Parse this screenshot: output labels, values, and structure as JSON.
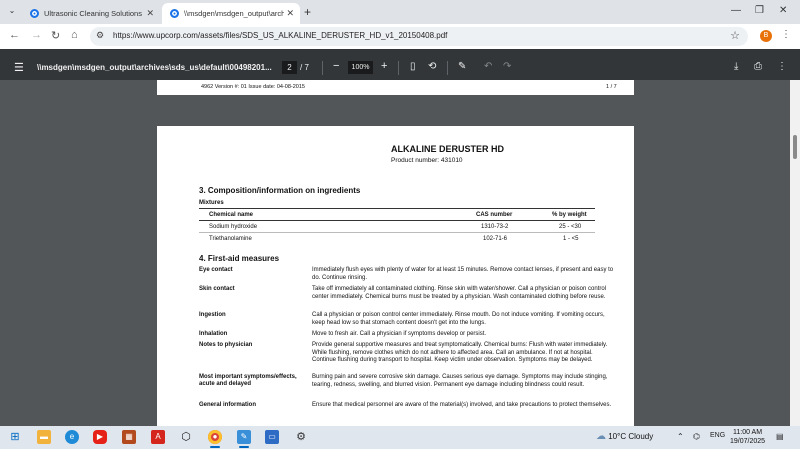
{
  "browser": {
    "tabs": [
      {
        "title": "Ultrasonic Cleaning Solutions &",
        "active": false
      },
      {
        "title": "\\\\msdgen\\msdgen_output\\arch",
        "active": true
      }
    ],
    "new_tab": "+",
    "url": "https://www.upcorp.com/assets/files/SDS_US_ALKALINE_DERUSTER_HD_v1_20150408.pdf",
    "profile_initial": "B"
  },
  "pdf_toolbar": {
    "filename": "\\\\msdgen\\msdgen_output\\archives\\sds_us\\default\\00498201...",
    "current_page": "2",
    "total_pages": "/ 7",
    "zoom": "100%"
  },
  "page1": {
    "footer": "4962    Version #: 01    Issue date: 04-08-2015",
    "page_number": "1 / 7"
  },
  "page2": {
    "title": "ALKALINE DERUSTER HD",
    "product_number": "Product number: 431010",
    "section3": {
      "heading": "3. Composition/information on ingredients",
      "subheading": "Mixtures",
      "columns": [
        "Chemical name",
        "CAS number",
        "% by weight"
      ],
      "rows": [
        [
          "Sodium hydroxide",
          "1310-73-2",
          "25 - <30"
        ],
        [
          "Triethanolamine",
          "102-71-6",
          "1 - <5"
        ]
      ]
    },
    "section4": {
      "heading": "4. First-aid measures",
      "items": [
        {
          "label": "Eye contact",
          "text": "Immediately flush eyes with plenty of water for at least 15 minutes. Remove contact lenses, if present and easy to do. Continue rinsing."
        },
        {
          "label": "Skin contact",
          "text": "Take off immediately all contaminated clothing. Rinse skin with water/shower. Call a physician or poison control center immediately. Chemical burns must be treated by a physician. Wash contaminated clothing before reuse."
        },
        {
          "label": "Ingestion",
          "text": "Call a physician or poison control center immediately. Rinse mouth. Do not induce vomiting. If vomiting occurs, keep head low so that stomach content doesn't get into the lungs."
        },
        {
          "label": "Inhalation",
          "text": "Move to fresh air. Call a physician if symptoms develop or persist."
        },
        {
          "label": "Notes to physician",
          "text": "Provide general supportive measures and treat symptomatically. Chemical burns: Flush with water immediately. While flushing, remove clothes which do not adhere to affected area. Call an ambulance. If not at hospital. Continue flushing during transport to hospital. Keep victim under observation. Symptoms may be delayed."
        },
        {
          "label": "Most important symptoms/effects, acute and delayed",
          "text": "Burning pain and severe corrosive skin damage. Causes serious eye damage. Symptoms may include stinging, tearing, redness, swelling, and blurred vision. Permanent eye damage including blindness could result."
        },
        {
          "label": "General information",
          "text": "Ensure that medical personnel are aware of the material(s) involved, and take precautions to protect themselves."
        }
      ]
    }
  },
  "taskbar": {
    "weather": "10°C  Cloudy",
    "language": "ENG",
    "time": "11:00 AM",
    "date": "19/07/2025"
  }
}
